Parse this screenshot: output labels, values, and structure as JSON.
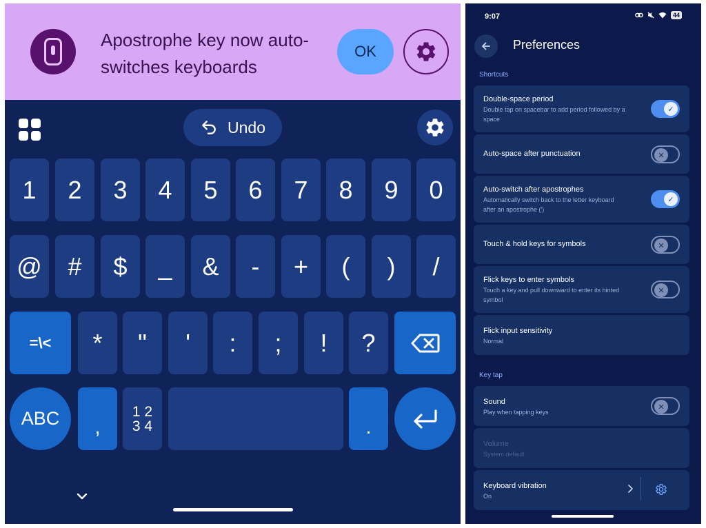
{
  "colors": {
    "banner_bg": "#d8a7f5",
    "keyboard_bg": "#0f2358",
    "key_bg": "#1d3c82",
    "action_key_bg": "#1766c8",
    "ok_button_bg": "#5aa5ff",
    "prefs_bg": "#0b1a4a",
    "toggle_on": "#4d8ef0"
  },
  "banner": {
    "logo_icon": "keyboard-logo-icon",
    "message": "Apostrophe key now auto-switches keyboards",
    "ok_label": "OK",
    "settings_icon": "gear-icon"
  },
  "keyboard": {
    "toolbar": {
      "apps_icon": "apps-grid-icon",
      "undo_label": "Undo",
      "undo_icon": "undo-arrow-icon",
      "settings_icon": "gear-icon"
    },
    "row1": [
      "1",
      "2",
      "3",
      "4",
      "5",
      "6",
      "7",
      "8",
      "9",
      "0"
    ],
    "row2": [
      "@",
      "#",
      "$",
      "_",
      "&",
      "-",
      "+",
      "(",
      ")",
      "/"
    ],
    "row3": [
      "*",
      "\"",
      "'",
      ":",
      ";",
      "!",
      "?"
    ],
    "symbols_key": "=\\<",
    "backspace_icon": "backspace-icon",
    "abc_key": "ABC",
    "comma_key": ",",
    "numpad_key": "1 2\n3 4",
    "period_key": ".",
    "enter_icon": "enter-icon",
    "collapse_icon": "chevron-down-icon"
  },
  "prefs": {
    "status_time": "9:07",
    "battery": "44",
    "title": "Preferences",
    "sections": {
      "shortcuts": "Shortcuts",
      "key_tap": "Key tap"
    },
    "items": {
      "double_space": {
        "title": "Double-space period",
        "desc": "Double tap on spacebar to add period followed by a space",
        "enabled": true
      },
      "auto_space": {
        "title": "Auto-space after punctuation",
        "enabled": false
      },
      "auto_switch": {
        "title": "Auto-switch after apostrophes",
        "desc": "Automatically switch back to the letter keyboard after an apostrophe (')",
        "enabled": true
      },
      "touch_hold": {
        "title": "Touch & hold keys for symbols",
        "enabled": false
      },
      "flick_keys": {
        "title": "Flick keys to enter symbols",
        "desc": "Touch a key and pull downward to enter its hinted symbol",
        "enabled": false
      },
      "flick_sensitivity": {
        "title": "Flick input sensitivity",
        "value": "Normal"
      },
      "sound": {
        "title": "Sound",
        "desc": "Play when tapping keys",
        "enabled": false
      },
      "volume": {
        "title": "Volume",
        "value": "System default"
      },
      "vibration": {
        "title": "Keyboard vibration",
        "value": "On"
      }
    }
  }
}
